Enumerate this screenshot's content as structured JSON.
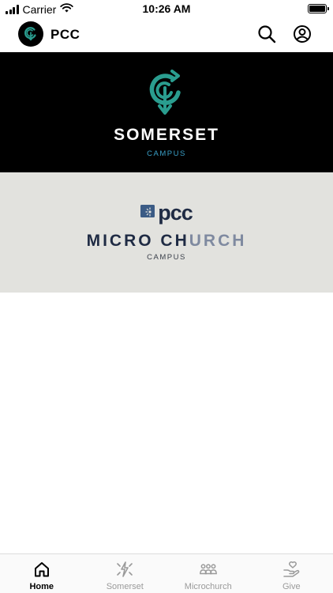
{
  "status_bar": {
    "carrier": "Carrier",
    "time": "10:26 AM"
  },
  "header": {
    "title": "PCC",
    "icons": [
      "pcc-logo-icon",
      "search-icon",
      "account-icon"
    ]
  },
  "campuses": [
    {
      "name": "SOMERSET",
      "subtitle": "CAMPUS",
      "background": "#000000",
      "name_color": "#ffffff",
      "subtitle_color": "#3aa0c8",
      "accent": "#2a9d8f"
    },
    {
      "brand": "pcc",
      "name_part1": "MICRO CH",
      "name_part2": "URCH",
      "subtitle": "CAMPUS",
      "background": "#e2e2de",
      "name_color": "#1f2b44"
    }
  ],
  "tab_bar": {
    "tabs": [
      {
        "label": "Home",
        "icon": "home-icon",
        "active": true
      },
      {
        "label": "Somerset",
        "icon": "somerset-icon",
        "active": false
      },
      {
        "label": "Microchurch",
        "icon": "microchurch-icon",
        "active": false
      },
      {
        "label": "Give",
        "icon": "give-icon",
        "active": false
      }
    ]
  }
}
